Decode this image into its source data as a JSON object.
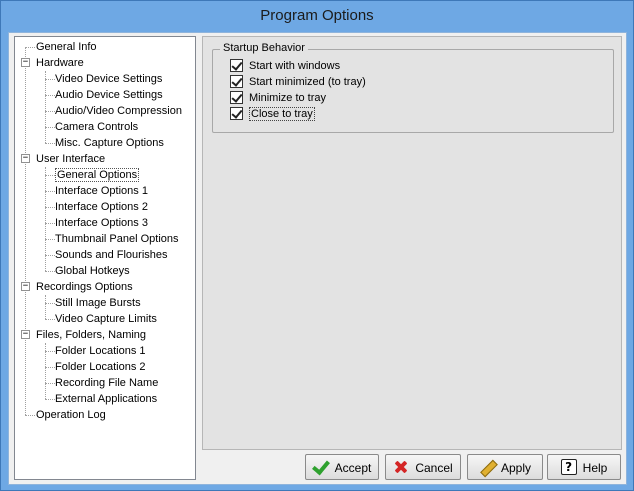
{
  "window": {
    "title": "Program Options"
  },
  "tree": {
    "items": [
      {
        "label": "General Info",
        "level": 0
      },
      {
        "label": "Hardware",
        "level": 0,
        "expander": "⊟"
      },
      {
        "label": "Video Device Settings",
        "level": 1
      },
      {
        "label": "Audio Device Settings",
        "level": 1
      },
      {
        "label": "Audio/Video Compression",
        "level": 1
      },
      {
        "label": "Camera Controls",
        "level": 1
      },
      {
        "label": "Misc. Capture Options",
        "level": 1
      },
      {
        "label": "User Interface",
        "level": 0,
        "expander": "⊟"
      },
      {
        "label": "General Options",
        "level": 1,
        "selected": true
      },
      {
        "label": "Interface Options 1",
        "level": 1
      },
      {
        "label": "Interface Options 2",
        "level": 1
      },
      {
        "label": "Interface Options 3",
        "level": 1
      },
      {
        "label": "Thumbnail Panel Options",
        "level": 1
      },
      {
        "label": "Sounds and Flourishes",
        "level": 1
      },
      {
        "label": "Global Hotkeys",
        "level": 1
      },
      {
        "label": "Recordings Options",
        "level": 0,
        "expander": "⊟"
      },
      {
        "label": "Still Image Bursts",
        "level": 1
      },
      {
        "label": "Video Capture Limits",
        "level": 1
      },
      {
        "label": "Files, Folders, Naming",
        "level": 0,
        "expander": "⊟"
      },
      {
        "label": "Folder Locations 1",
        "level": 1
      },
      {
        "label": "Folder Locations 2",
        "level": 1
      },
      {
        "label": "Recording File Name",
        "level": 1
      },
      {
        "label": "External Applications",
        "level": 1
      },
      {
        "label": "Operation Log",
        "level": 0
      }
    ]
  },
  "startup_group": {
    "title": "Startup Behavior",
    "options": [
      {
        "label": "Start with windows",
        "checked": true
      },
      {
        "label": "Start minimized (to tray)",
        "checked": true
      },
      {
        "label": "Minimize to tray",
        "checked": true
      },
      {
        "label": "Close to tray",
        "checked": true,
        "focused": true
      }
    ]
  },
  "buttons": {
    "accept": "Accept",
    "cancel": "Cancel",
    "apply": "Apply",
    "help": "Help",
    "help_icon_glyph": "?"
  },
  "icons": {
    "accept": "green-checkmark-icon",
    "cancel": "red-x-icon",
    "apply": "pencil-icon",
    "help": "help-icon"
  },
  "colors": {
    "titlebar": "#6ea8e4",
    "accept_icon": "#2ea12e",
    "cancel_icon": "#d42525"
  }
}
